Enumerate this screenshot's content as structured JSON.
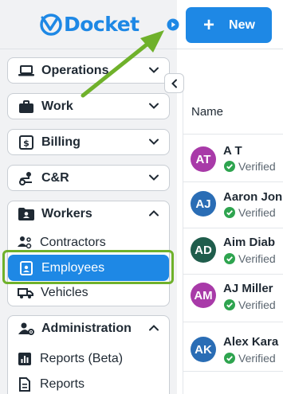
{
  "app": {
    "logo_text": "Docket",
    "brand_color": "#1e88e5"
  },
  "header": {
    "new_button_label": "New",
    "new_button_icon": "plus-icon"
  },
  "sidebar": {
    "groups": [
      {
        "label": "Operations",
        "icon": "laptop-icon",
        "state": "collapsed"
      },
      {
        "label": "Work",
        "icon": "briefcase-icon",
        "state": "collapsed"
      },
      {
        "label": "Billing",
        "icon": "dollar-icon",
        "state": "collapsed"
      },
      {
        "label": "C&R",
        "icon": "route-icon",
        "state": "collapsed"
      },
      {
        "label": "Workers",
        "icon": "folder-person-icon",
        "state": "expanded",
        "items": [
          {
            "label": "Contractors",
            "icon": "contractors-icon"
          },
          {
            "label": "Employees",
            "icon": "badge-icon",
            "active": true
          },
          {
            "label": "Vehicles",
            "icon": "truck-icon"
          }
        ]
      },
      {
        "label": "Administration",
        "icon": "users-gear-icon",
        "state": "expanded",
        "items": [
          {
            "label": "Reports (Beta)",
            "icon": "bar-chart-icon"
          },
          {
            "label": "Reports",
            "icon": "document-icon"
          }
        ]
      }
    ]
  },
  "table": {
    "header_name": "Name",
    "rows": [
      {
        "initials": "AT",
        "name": "A T",
        "status": "Verified",
        "avatar_color": "#a83aa8"
      },
      {
        "initials": "AJ",
        "name": "Aaron Jon",
        "status": "Verified",
        "avatar_color": "#2a6db5"
      },
      {
        "initials": "AD",
        "name": "Aim Diab",
        "status": "Verified",
        "avatar_color": "#1f5d4c"
      },
      {
        "initials": "AM",
        "name": "AJ Miller",
        "status": "Verified",
        "avatar_color": "#a83aa8"
      },
      {
        "initials": "AK",
        "name": "Alex Kara",
        "status": "Verified",
        "avatar_color": "#2a6db5"
      }
    ]
  },
  "annotation": {
    "highlight_color": "#6fb12b"
  }
}
